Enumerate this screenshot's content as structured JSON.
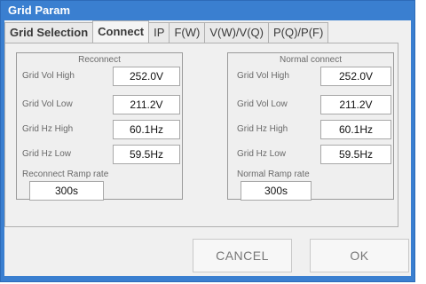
{
  "window": {
    "title": "Grid Param"
  },
  "tabs": [
    {
      "label": "Grid Selection"
    },
    {
      "label": "Connect"
    },
    {
      "label": "IP"
    },
    {
      "label": "F(W)"
    },
    {
      "label": "V(W)/V(Q)"
    },
    {
      "label": "P(Q)/P(F)"
    }
  ],
  "reconnect": {
    "title": "Reconnect",
    "rows": [
      {
        "label": "Grid Vol High",
        "value": "252.0V"
      },
      {
        "label": "Grid Vol Low",
        "value": "211.2V"
      },
      {
        "label": "Grid Hz High",
        "value": "60.1Hz"
      },
      {
        "label": "Grid Hz Low",
        "value": "59.5Hz"
      }
    ],
    "ramp_label": "Reconnect Ramp rate",
    "ramp_value": "300s"
  },
  "normal": {
    "title": "Normal connect",
    "rows": [
      {
        "label": "Grid Vol High",
        "value": "252.0V"
      },
      {
        "label": "Grid Vol Low",
        "value": "211.2V"
      },
      {
        "label": "Grid Hz High",
        "value": "60.1Hz"
      },
      {
        "label": "Grid Hz Low",
        "value": "59.5Hz"
      }
    ],
    "ramp_label": "Normal Ramp rate",
    "ramp_value": "300s"
  },
  "buttons": {
    "cancel": "CANCEL",
    "ok": "OK"
  }
}
